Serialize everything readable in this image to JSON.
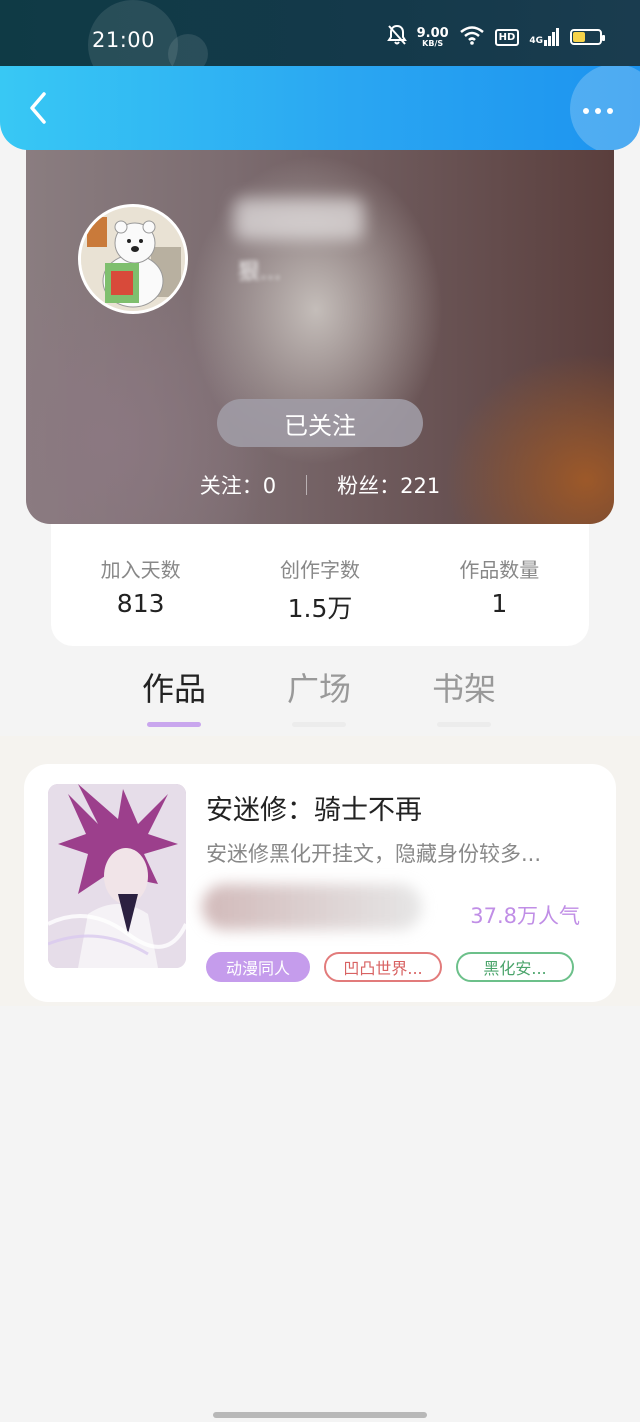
{
  "status_bar": {
    "time": "21:00",
    "net_speed_value": "9.00",
    "net_speed_unit": "KB/S",
    "hd": "HD",
    "network": "4G",
    "battery_level": 0.45,
    "icons": [
      "mute-bell-icon",
      "wifi-icon",
      "signal-icon",
      "battery-icon"
    ]
  },
  "header": {
    "back_icon": "chevron-left-icon",
    "more_icon": "more-dots-icon"
  },
  "profile": {
    "bio": "狠...",
    "follow_button": "已关注",
    "following_label": "关注：0",
    "fans_label": "粉丝：221"
  },
  "stats": [
    {
      "label": "加入天数",
      "value": "813"
    },
    {
      "label": "创作字数",
      "value": "1.5万"
    },
    {
      "label": "作品数量",
      "value": "1"
    }
  ],
  "tabs": [
    {
      "label": "作品",
      "active": true
    },
    {
      "label": "广场",
      "active": false
    },
    {
      "label": "书架",
      "active": false
    }
  ],
  "work": {
    "title": "安迷修：骑士不再",
    "description": "安迷修黑化开挂文，隐藏身份较多...",
    "popularity": "37.8万人气",
    "tags": [
      "动漫同人",
      "凹凸世界...",
      "黑化安..."
    ]
  },
  "colors": {
    "header_gradient_start": "#38c8f4",
    "header_gradient_end": "#1c93ef",
    "accent_purple": "#c59cec",
    "tag_red": "#e27b7b",
    "tag_green": "#6cc08a"
  }
}
